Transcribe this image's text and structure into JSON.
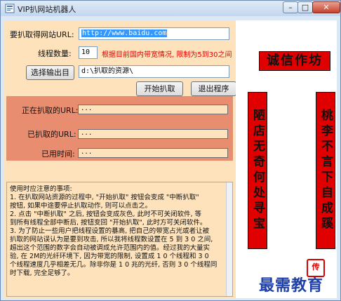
{
  "window": {
    "title": "VIP扒网站机器人",
    "controls": {
      "minimize": "–",
      "maximize": "□",
      "close": "✕"
    }
  },
  "form": {
    "url_label": "要扒取得网站URL:",
    "url_value": "http://www.baidu.com",
    "threads_label": "线程数量:",
    "threads_value": "10",
    "threads_note": "根据目前国内带宽情况, 限制为5到30之间",
    "choose_dir_button": "选择输出目",
    "dir_value": "d:\\扒取的资源\\",
    "start_button": "开始扒取",
    "exit_button": "退出程序"
  },
  "status": {
    "current_url_label": "正在扒取的URL:",
    "current_url_value": "...",
    "done_url_label": "已扒取的URL:",
    "done_url_value": "...",
    "elapsed_label": "已用时间:",
    "elapsed_value": "..."
  },
  "notes": {
    "lines": [
      "使用时应注意的事项:",
      "1. 在扒取网站资源的过程中, \"开始扒取\" 按钮会变成 \"中断扒取\"",
      "按钮, 如果中途要停止扒取动作, 则可以点击之。",
      "2. 点击 \"中断扒取\" 之后, 按钮会变成灰色, 此时不可关闭软件, 等",
      "到所有线程全部中断后, 按钮变回 \"开始扒取\", 此时方可关闭软件。",
      "3. 为了防止一些用户把线程设置的暴高, 把自己的带宽占光或者让被",
      "扒取的网站误认为是要到攻击, 所以我将线程数设置在 5 到 3 0 之间,",
      "超出这个范围的数字会自动被调成允许范围内的值。经过我的大量实",
      "验, 在 2M的光纤环境下, 因为带宽的限制, 设置成 1 0 个线程和 3 0",
      "个线程速度几乎相差无几。除非你是 1 0 兆的光纤, 否则 3 0 个线程同",
      "时下载, 完全足够了。"
    ]
  },
  "decor": {
    "horizontal_scroll": "诚信作坊",
    "couplet_left": "陋店无奇何处寻宝",
    "couplet_right": "桃李不言下自成蹊",
    "seal_text": "传",
    "watermark": "最需教育"
  }
}
